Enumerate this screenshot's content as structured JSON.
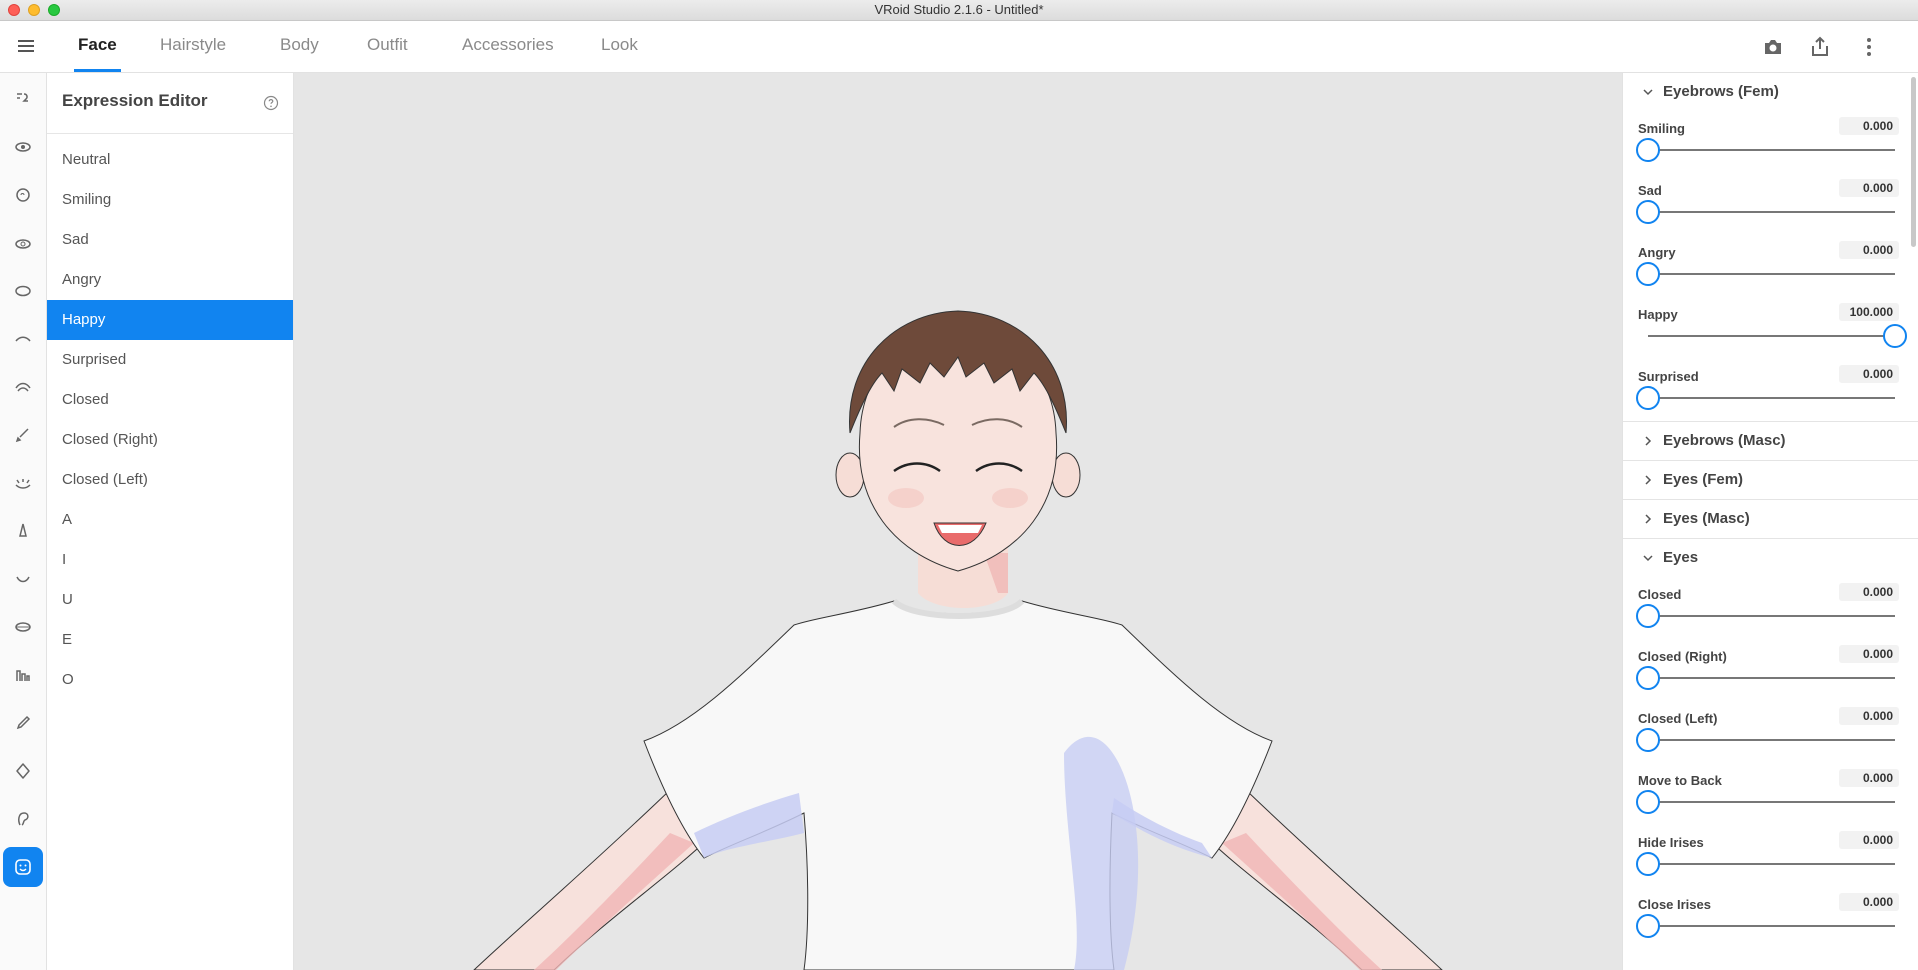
{
  "window": {
    "title": "VRoid Studio 2.1.6 - Untitled*"
  },
  "tabs": [
    {
      "label": "Face"
    },
    {
      "label": "Hairstyle"
    },
    {
      "label": "Body"
    },
    {
      "label": "Outfit"
    },
    {
      "label": "Accessories"
    },
    {
      "label": "Look"
    }
  ],
  "active_tab": "Face",
  "top_actions": [
    "camera-icon",
    "share-icon",
    "more-vertical-icon"
  ],
  "rail_icons": [
    "face-set-icon",
    "eye-icon",
    "ear-icon",
    "eye-lash-icon",
    "eye-shape-icon",
    "eyebrow-icon",
    "eyebrow-curve-icon",
    "brush-icon",
    "eyelash-icon",
    "nose-icon",
    "mouth-icon",
    "lips-icon",
    "teeth-icon",
    "pen-icon",
    "head-shape-icon",
    "ear-shape-icon",
    "expression-icon"
  ],
  "expression_editor": {
    "title": "Expression Editor",
    "items": [
      "Neutral",
      "Smiling",
      "Sad",
      "Angry",
      "Happy",
      "Surprised",
      "Closed",
      "Closed (Right)",
      "Closed (Left)",
      "A",
      "I",
      "U",
      "E",
      "O"
    ],
    "selected": "Happy"
  },
  "right_panel": {
    "eyebrows_fem": {
      "title": "Eyebrows (Fem)",
      "sliders": [
        {
          "label": "Smiling",
          "value": "0.000",
          "level": 0
        },
        {
          "label": "Sad",
          "value": "0.000",
          "level": 0
        },
        {
          "label": "Angry",
          "value": "0.000",
          "level": 0
        },
        {
          "label": "Happy",
          "value": "100.000",
          "level": 1
        },
        {
          "label": "Surprised",
          "value": "0.000",
          "level": 0
        }
      ]
    },
    "collapsed_sections": [
      "Eyebrows (Masc)",
      "Eyes (Fem)",
      "Eyes (Masc)"
    ],
    "eyes": {
      "title": "Eyes",
      "sliders": [
        {
          "label": "Closed",
          "value": "0.000",
          "level": 0
        },
        {
          "label": "Closed (Right)",
          "value": "0.000",
          "level": 0
        },
        {
          "label": "Closed (Left)",
          "value": "0.000",
          "level": 0
        },
        {
          "label": "Move to Back",
          "value": "0.000",
          "level": 0
        },
        {
          "label": "Hide Irises",
          "value": "0.000",
          "level": 0
        },
        {
          "label": "Close Irises",
          "value": "0.000",
          "level": 0
        }
      ]
    }
  },
  "colors": {
    "accent": "#1184f0"
  }
}
